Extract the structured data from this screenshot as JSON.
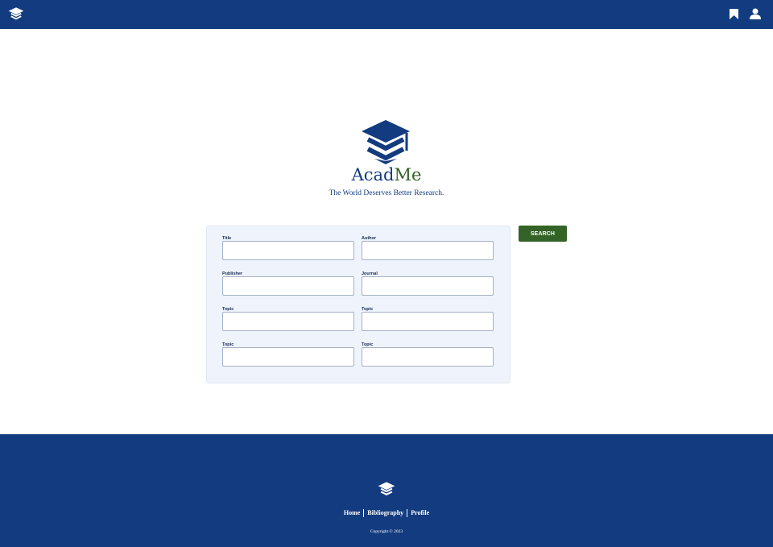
{
  "app": {
    "icons": {
      "logo": "graduation-cap-icon",
      "bookmark": "bookmark-icon",
      "user": "user-icon"
    }
  },
  "brand": {
    "name_part1": "Acad",
    "name_part2": "Me",
    "tagline": "The World Deserves Better Research."
  },
  "form": {
    "fields": [
      {
        "label": "Title",
        "value": ""
      },
      {
        "label": "Author",
        "value": ""
      },
      {
        "label": "Publisher",
        "value": ""
      },
      {
        "label": "Journal",
        "value": ""
      },
      {
        "label": "Topic",
        "value": ""
      },
      {
        "label": "Topic",
        "value": ""
      },
      {
        "label": "Topic",
        "value": ""
      },
      {
        "label": "Topic",
        "value": ""
      }
    ],
    "search_label": "SEARCH"
  },
  "footer": {
    "links": [
      "Home",
      "Bibliography",
      "Profile"
    ],
    "copyright": "Copyright © 2023"
  },
  "colors": {
    "primary": "#133b7f",
    "accent": "#336326",
    "panel": "#eef3fc"
  }
}
